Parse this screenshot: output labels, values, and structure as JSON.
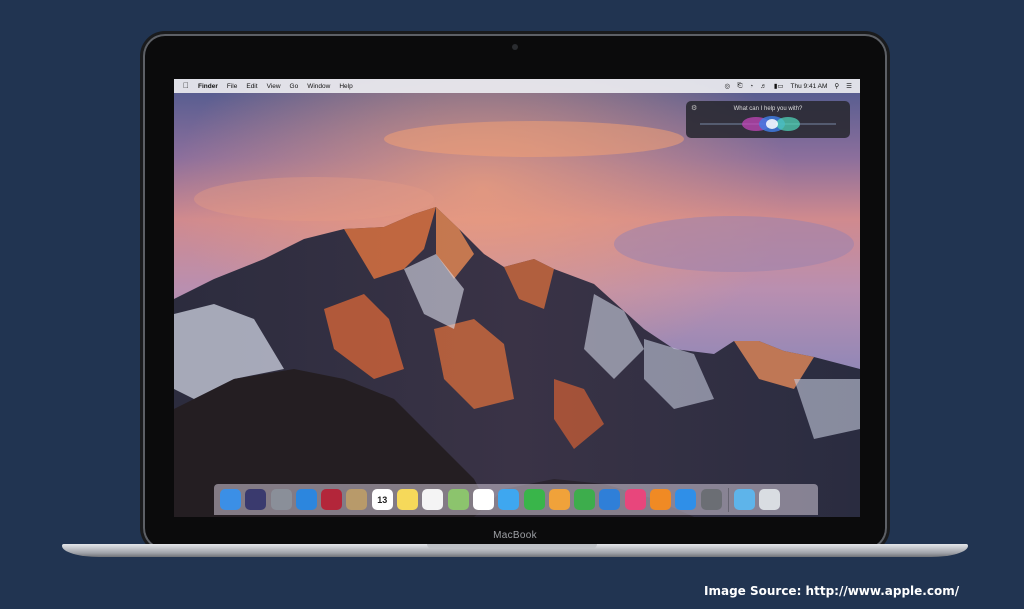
{
  "menubar": {
    "apple_icon": "apple-logo-icon",
    "items": [
      "Finder",
      "File",
      "Edit",
      "View",
      "Go",
      "Window",
      "Help"
    ],
    "clock": "Thu 9:41 AM",
    "status_icons": [
      "siri-icon",
      "bluetooth-icon",
      "wifi-icon",
      "volume-icon",
      "battery-icon",
      "spotlight-icon",
      "notification-center-icon"
    ]
  },
  "siri": {
    "prompt": "What can I help you with?"
  },
  "dock": {
    "apps": [
      {
        "name": "Finder",
        "icon": "finder-icon",
        "color": "#3b8fe6"
      },
      {
        "name": "Siri",
        "icon": "siri-icon",
        "color": "#3a3a6e"
      },
      {
        "name": "Launchpad",
        "icon": "launchpad-icon",
        "color": "#8a8f99"
      },
      {
        "name": "Safari",
        "icon": "safari-icon",
        "color": "#2c86de"
      },
      {
        "name": "Photo Booth",
        "icon": "photo-booth-icon",
        "color": "#b3263a"
      },
      {
        "name": "Contacts",
        "icon": "contacts-icon",
        "color": "#b89a6a"
      },
      {
        "name": "Calendar",
        "icon": "calendar-icon",
        "color": "#ffffff",
        "label": "13"
      },
      {
        "name": "Notes",
        "icon": "notes-icon",
        "color": "#f6d95a"
      },
      {
        "name": "Reminders",
        "icon": "reminders-icon",
        "color": "#f4f4f4"
      },
      {
        "name": "Maps",
        "icon": "maps-icon",
        "color": "#8cc46d"
      },
      {
        "name": "Photos",
        "icon": "photos-icon",
        "color": "#ffffff"
      },
      {
        "name": "Messages",
        "icon": "messages-icon",
        "color": "#3ea7f0"
      },
      {
        "name": "FaceTime",
        "icon": "facetime-icon",
        "color": "#39b54a"
      },
      {
        "name": "Pages",
        "icon": "pages-icon",
        "color": "#f0a23a"
      },
      {
        "name": "Numbers",
        "icon": "numbers-icon",
        "color": "#3dad4c"
      },
      {
        "name": "Keynote",
        "icon": "keynote-icon",
        "color": "#2f7fd8"
      },
      {
        "name": "iTunes",
        "icon": "itunes-icon",
        "color": "#e8467c"
      },
      {
        "name": "iBooks",
        "icon": "ibooks-icon",
        "color": "#f08a24"
      },
      {
        "name": "App Store",
        "icon": "app-store-icon",
        "color": "#2f8fe8"
      },
      {
        "name": "System Preferences",
        "icon": "system-preferences-icon",
        "color": "#6b6e74"
      }
    ],
    "trailing": [
      {
        "name": "Downloads",
        "icon": "downloads-folder-icon",
        "color": "#5eb4ea"
      },
      {
        "name": "Trash",
        "icon": "trash-icon",
        "color": "#d9dde2"
      }
    ]
  },
  "device": {
    "brand": "MacBook"
  },
  "caption": "Image Source: http://www.apple.com/"
}
